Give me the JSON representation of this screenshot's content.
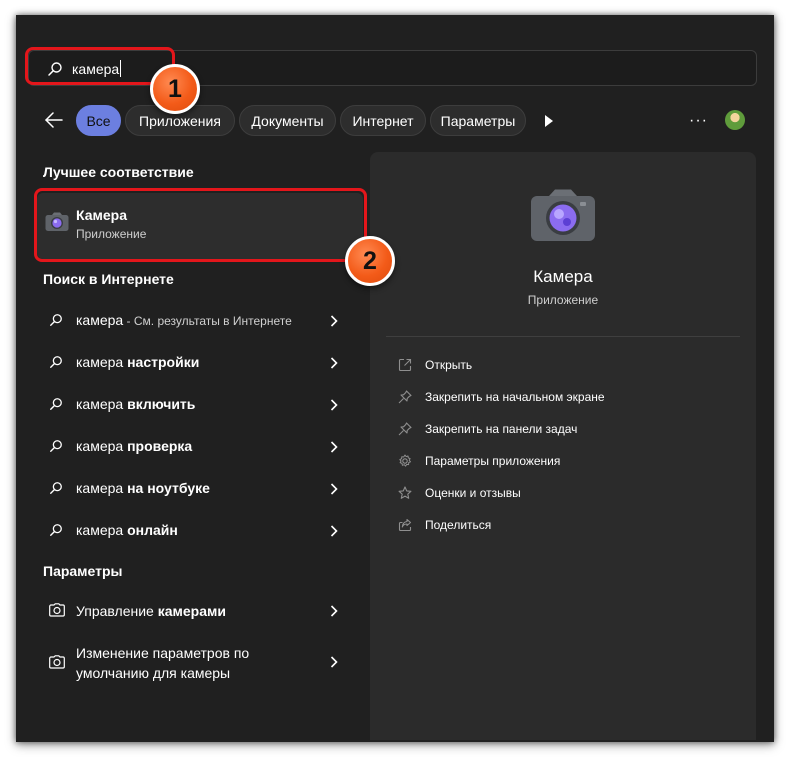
{
  "search": {
    "query": "камера"
  },
  "markers": [
    "1",
    "2"
  ],
  "filters": [
    {
      "label": "Все",
      "active": true
    },
    {
      "label": "Приложения"
    },
    {
      "label": "Документы"
    },
    {
      "label": "Интернет"
    },
    {
      "label": "Параметры"
    }
  ],
  "toolbar": {
    "more_label": "···"
  },
  "best_match": {
    "heading": "Лучшее соответствие",
    "title": "Камера",
    "subtitle": "Приложение"
  },
  "web": {
    "heading": "Поиск в Интернете",
    "items": [
      {
        "base": "камера",
        "bold": "",
        "hint": " - См. результаты в Интернете"
      },
      {
        "base": "камера ",
        "bold": "настройки",
        "hint": ""
      },
      {
        "base": "камера ",
        "bold": "включить",
        "hint": ""
      },
      {
        "base": "камера ",
        "bold": "проверка",
        "hint": ""
      },
      {
        "base": "камера ",
        "bold": "на ноутбуке",
        "hint": ""
      },
      {
        "base": "камера ",
        "bold": "онлайн",
        "hint": ""
      }
    ]
  },
  "settings": {
    "heading": "Параметры",
    "item1": {
      "base": "Управление ",
      "bold": "камерами"
    },
    "item2": {
      "line1": "Изменение параметров по",
      "line2": "умолчанию для камеры"
    }
  },
  "preview": {
    "title": "Камера",
    "subtitle": "Приложение",
    "actions": [
      {
        "label": "Открыть",
        "icon": "open-icon"
      },
      {
        "label": "Закрепить на начальном экране",
        "icon": "pin-icon"
      },
      {
        "label": "Закрепить на панели задач",
        "icon": "pin-icon"
      },
      {
        "label": "Параметры приложения",
        "icon": "gear-icon"
      },
      {
        "label": "Оценки и отзывы",
        "icon": "star-icon"
      },
      {
        "label": "Поделиться",
        "icon": "share-icon"
      }
    ]
  },
  "colors": {
    "accent": "#6c7fe0",
    "background": "#202020",
    "panel": "#2b2b2b",
    "highlight": "#e3161b",
    "marker": "#f35b19"
  }
}
